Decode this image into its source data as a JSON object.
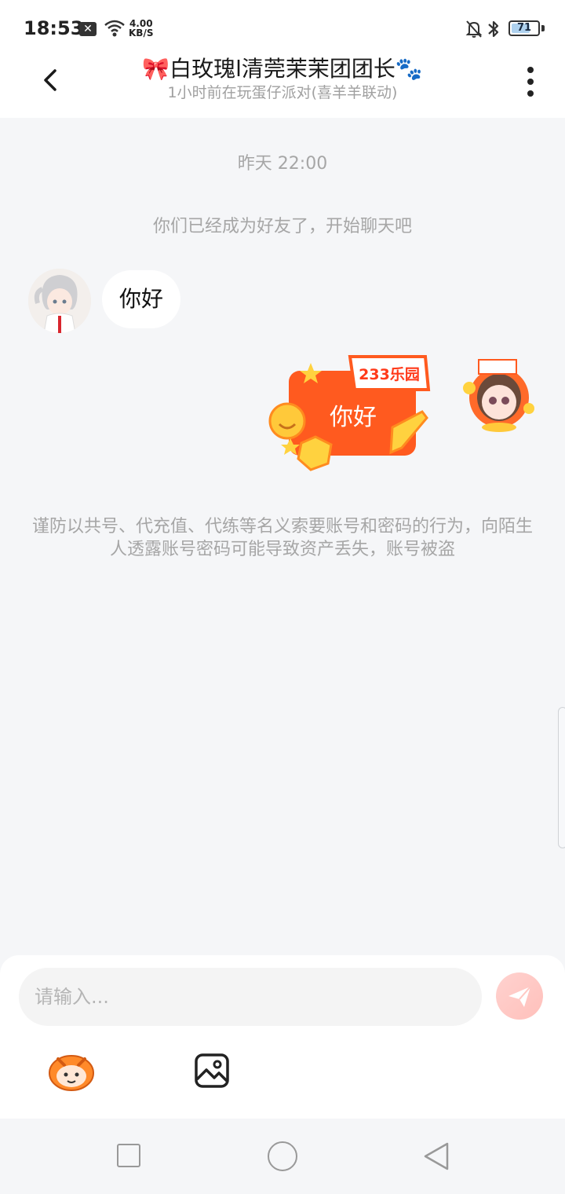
{
  "status_bar": {
    "time": "18:53",
    "close_badge": "✕",
    "net_speed_value": "4.00",
    "net_speed_unit": "KB/S",
    "battery_level": "71",
    "battery_fraction": 0.71,
    "icons": [
      "close-notification-icon",
      "wifi-icon",
      "mute-bell-icon",
      "bluetooth-icon",
      "battery-icon"
    ]
  },
  "header": {
    "title": "🎀白玫瑰l清莞茉茉团团长🐾",
    "subtitle": "1小时前在玩蛋仔派对(喜羊羊联动)",
    "back_icon": "chevron-left-icon",
    "more_icon": "more-vertical-icon"
  },
  "chat": {
    "timestamp": "昨天 22:00",
    "system_message": "你们已经成为好友了，开始聊天吧",
    "messages": [
      {
        "side": "left",
        "type": "text",
        "text": "你好"
      },
      {
        "side": "right",
        "type": "sticker",
        "text": "你好",
        "sticker_brand": "233乐园"
      }
    ],
    "warning": "谨防以共号、代充值、代练等名义索要账号和密码的行为，向陌生人透露账号密码可能导致资产丢失，账号被盗"
  },
  "input": {
    "placeholder": "请输入...",
    "value": "",
    "send_icon": "send-icon",
    "emoji_icon": "emoji-mascot-icon",
    "image_icon": "image-icon"
  },
  "nav": {
    "icons": [
      "recent-apps-icon",
      "home-icon",
      "back-icon"
    ]
  },
  "colors": {
    "accent": "#ff5a1f",
    "send_button": "#ffc8c3",
    "background": "#f5f6f8",
    "muted_text": "#a6a6a6"
  }
}
